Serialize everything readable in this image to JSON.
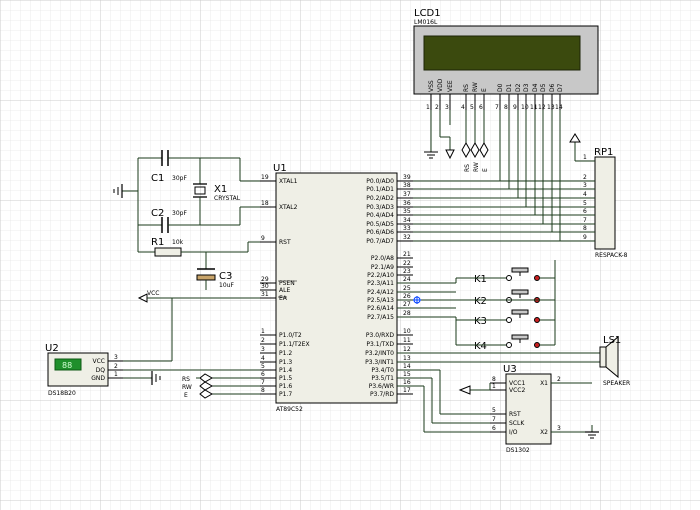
{
  "lcd": {
    "ref": "LCD1",
    "model": "LM016L",
    "pins": [
      {
        "name": "VSS",
        "num": "1"
      },
      {
        "name": "VDD",
        "num": "2"
      },
      {
        "name": "VEE",
        "num": "3"
      },
      {
        "name": "RS",
        "num": "4"
      },
      {
        "name": "RW",
        "num": "5"
      },
      {
        "name": "E",
        "num": "6"
      },
      {
        "name": "D0",
        "num": "7"
      },
      {
        "name": "D1",
        "num": "8"
      },
      {
        "name": "D2",
        "num": "9"
      },
      {
        "name": "D3",
        "num": "10"
      },
      {
        "name": "D4",
        "num": "11"
      },
      {
        "name": "D5",
        "num": "12"
      },
      {
        "name": "D6",
        "num": "13"
      },
      {
        "name": "D7",
        "num": "14"
      }
    ],
    "net_labels": [
      "RS",
      "RW",
      "E"
    ]
  },
  "mcu": {
    "ref": "U1",
    "model": "AT89C52",
    "left_pins": [
      {
        "name": "XTAL1",
        "num": "19"
      },
      {
        "name": "XTAL2",
        "num": "18"
      },
      {
        "name": "RST",
        "num": "9"
      },
      {
        "name": "PSEN",
        "num": "29"
      },
      {
        "name": "ALE",
        "num": "30"
      },
      {
        "name": "EA",
        "num": "31"
      },
      {
        "name": "P1.0/T2",
        "num": "1"
      },
      {
        "name": "P1.1/T2EX",
        "num": "2"
      },
      {
        "name": "P1.2",
        "num": "3"
      },
      {
        "name": "P1.3",
        "num": "4"
      },
      {
        "name": "P1.4",
        "num": "5"
      },
      {
        "name": "P1.5",
        "num": "6"
      },
      {
        "name": "P1.6",
        "num": "7"
      },
      {
        "name": "P1.7",
        "num": "8"
      }
    ],
    "right_pins": [
      {
        "name": "P0.0/AD0",
        "num": "39"
      },
      {
        "name": "P0.1/AD1",
        "num": "38"
      },
      {
        "name": "P0.2/AD2",
        "num": "37"
      },
      {
        "name": "P0.3/AD3",
        "num": "36"
      },
      {
        "name": "P0.4/AD4",
        "num": "35"
      },
      {
        "name": "P0.5/AD5",
        "num": "34"
      },
      {
        "name": "P0.6/AD6",
        "num": "33"
      },
      {
        "name": "P0.7/AD7",
        "num": "32"
      },
      {
        "name": "P2.0/A8",
        "num": "21"
      },
      {
        "name": "P2.1/A9",
        "num": "22"
      },
      {
        "name": "P2.2/A10",
        "num": "23"
      },
      {
        "name": "P2.3/A11",
        "num": "24"
      },
      {
        "name": "P2.4/A12",
        "num": "25"
      },
      {
        "name": "P2.5/A13",
        "num": "26"
      },
      {
        "name": "P2.6/A14",
        "num": "27"
      },
      {
        "name": "P2.7/A15",
        "num": "28"
      },
      {
        "name": "P3.0/RXD",
        "num": "10"
      },
      {
        "name": "P3.1/TXD",
        "num": "11"
      },
      {
        "name": "P3.2/INT0",
        "num": "12"
      },
      {
        "name": "P3.3/INT1",
        "num": "13"
      },
      {
        "name": "P3.4/T0",
        "num": "14"
      },
      {
        "name": "P3.5/T1",
        "num": "15"
      },
      {
        "name": "P3.6/WR",
        "num": "16"
      },
      {
        "name": "P3.7/RD",
        "num": "17"
      }
    ],
    "net_labels": [
      "RS",
      "RW",
      "E"
    ]
  },
  "rp": {
    "ref": "RP1",
    "model": "RESPACK-8",
    "pins": [
      "1",
      "2",
      "3",
      "4",
      "5",
      "6",
      "7",
      "8",
      "9"
    ]
  },
  "crystal": {
    "ref": "X1",
    "model": "CRYSTAL"
  },
  "c1": {
    "ref": "C1",
    "value": "30pF"
  },
  "c2": {
    "ref": "C2",
    "value": "30pF"
  },
  "c3": {
    "ref": "C3",
    "value": "10uF"
  },
  "r1": {
    "ref": "R1",
    "value": "10k"
  },
  "keys": [
    "K1",
    "K2",
    "K3",
    "K4"
  ],
  "vcc_label": "VCC",
  "u2": {
    "ref": "U2",
    "model": "DS18B20",
    "display": "88",
    "pins": [
      {
        "name": "VCC",
        "num": "3"
      },
      {
        "name": "DQ",
        "num": "2"
      },
      {
        "name": "GND",
        "num": "1"
      }
    ]
  },
  "u3": {
    "ref": "U3",
    "model": "DS1302",
    "left_pins": [
      {
        "name": "VCC1",
        "num": "8"
      },
      {
        "name": "VCC2",
        "num": "1"
      },
      {
        "name": "RST",
        "num": "5"
      },
      {
        "name": "SCLK",
        "num": "7"
      },
      {
        "name": "I/O",
        "num": "6"
      }
    ],
    "right_pins": [
      {
        "name": "X1",
        "num": "2"
      },
      {
        "name": "X2",
        "num": "3"
      }
    ]
  },
  "speaker": {
    "ref": "LS1",
    "model": "SPEAKER"
  }
}
